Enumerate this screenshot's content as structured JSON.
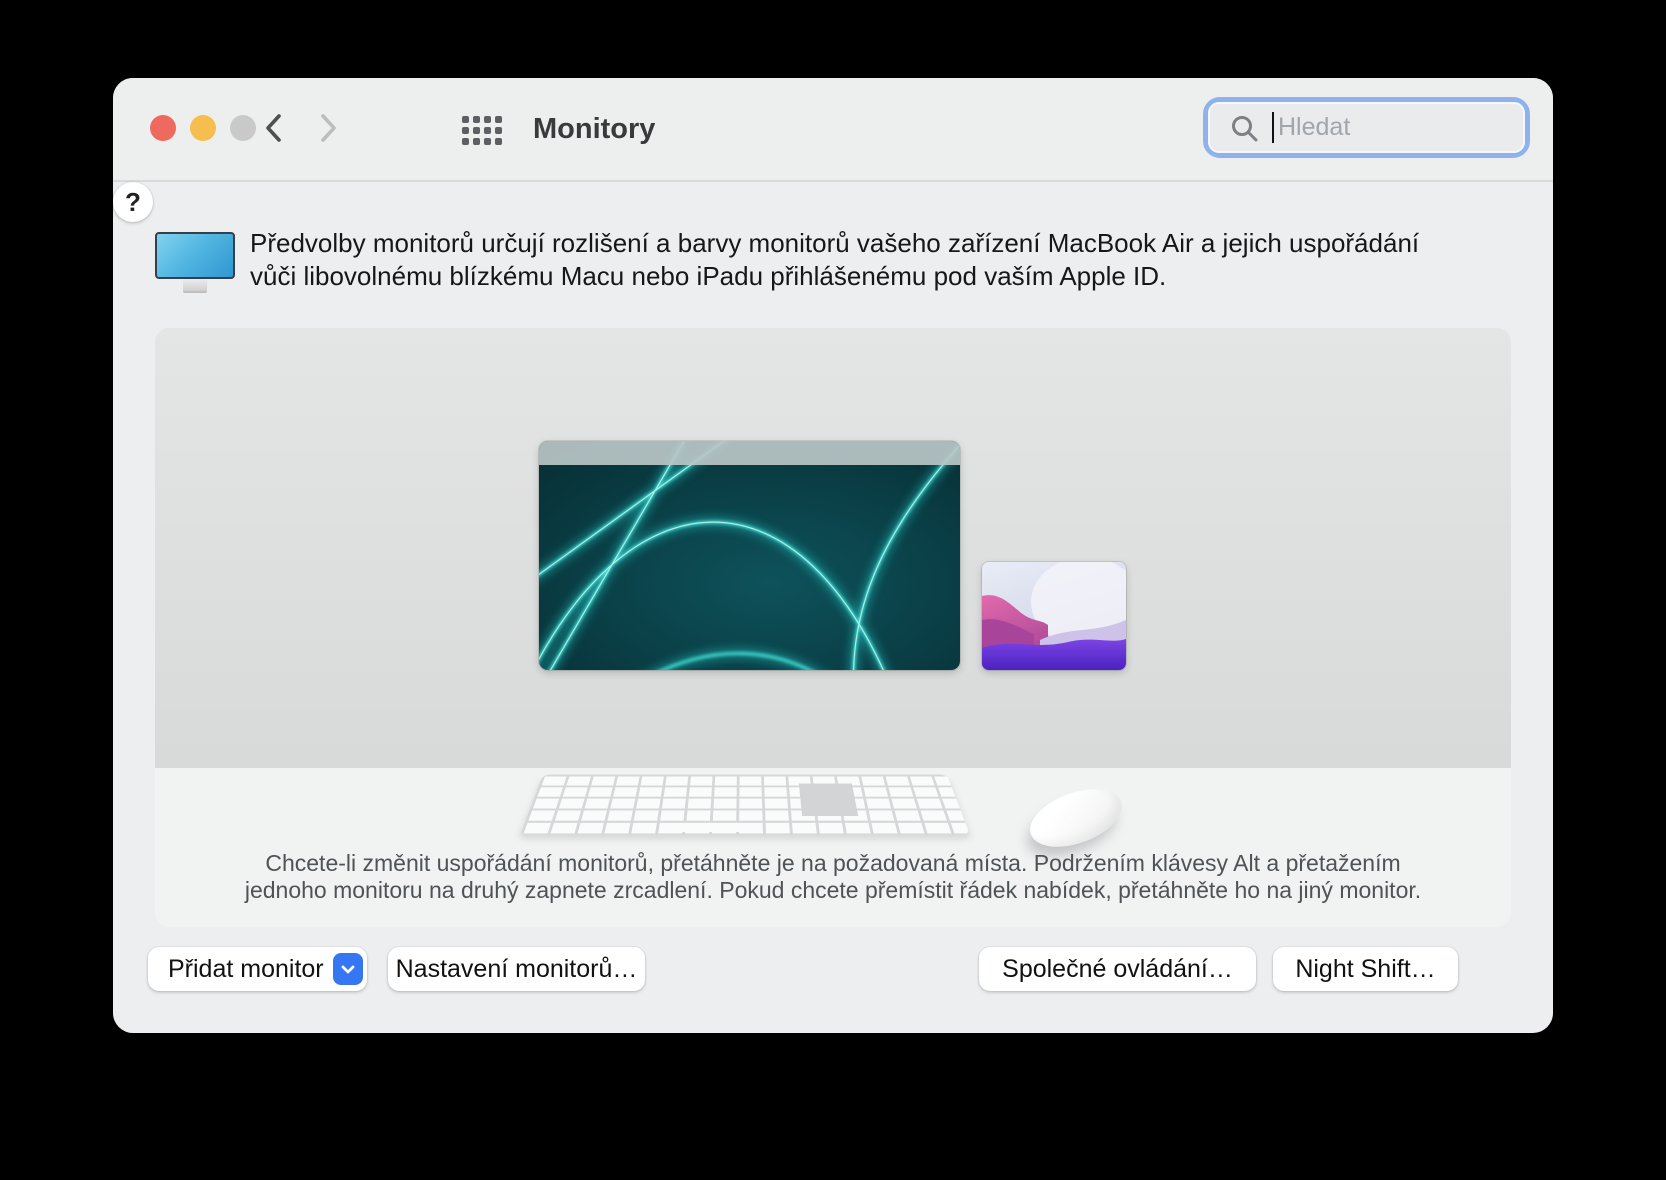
{
  "window": {
    "title": "Monitory"
  },
  "toolbar": {
    "search_placeholder": "Hledat",
    "icons": {
      "back": "chevron-left",
      "forward": "chevron-right",
      "apps": "grid-of-dots",
      "search": "magnifier",
      "dropdown": "chevron-down"
    }
  },
  "description": {
    "line1": "Předvolby monitorů určují rozlišení a barvy monitorů vašeho zařízení MacBook Air a jejich uspořádání",
    "line2": "vůči libovolnému blízkému Macu nebo iPadu přihlášenému pod vaším Apple ID."
  },
  "arrangement": {
    "hint_line1": "Chcete-li změnit uspořádání monitorů, přetáhněte je na požadovaná místa. Podržením klávesy Alt a přetažením",
    "hint_line2": "jednoho monitoru na druhý zapnete zrcadlení. Pokud chcete přemístit řádek nabídek, přetáhněte ho na jiný monitor."
  },
  "buttons": {
    "add_display": "Přidat monitor",
    "display_settings": "Nastavení monitorů…",
    "universal_control": "Společné ovládání…",
    "night_shift": "Night Shift…",
    "help": "?"
  },
  "colors": {
    "accent_blue": "#3577F2",
    "focus_ring": "#8FB2EE",
    "traffic_red": "#EE6A5E",
    "traffic_yellow": "#F5BE4F",
    "traffic_disabled": "#C9C9C9"
  }
}
